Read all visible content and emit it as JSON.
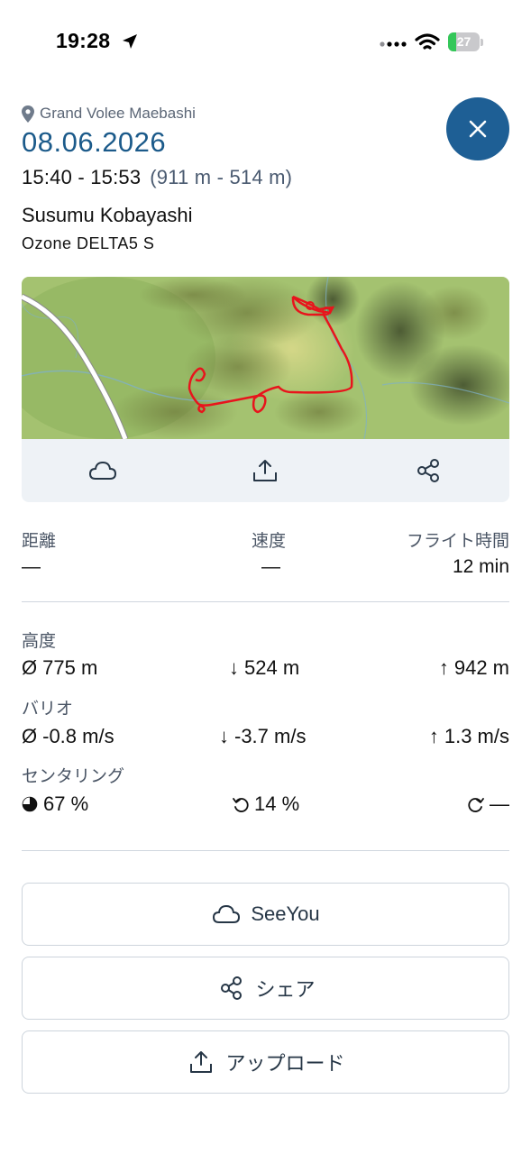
{
  "status_bar": {
    "time": "19:28",
    "battery": "27",
    "battery_level": 0.27,
    "colors": {
      "battery_fill": "#34c759",
      "battery_body": "#c9c9cc"
    }
  },
  "flight": {
    "place": "Grand Volee Maebashi",
    "date": "08.06.2026",
    "time_range": "15:40 - 15:53",
    "altitude_range": "(911 m - 514 m)",
    "pilot": "Susumu Kobayashi",
    "glider": "Ozone DELTA5 S"
  },
  "map_actions": [
    {
      "icon": "cloud-icon"
    },
    {
      "icon": "upload-icon"
    },
    {
      "icon": "share-icon"
    }
  ],
  "summary": {
    "distance_label": "距離",
    "distance_value": "—",
    "speed_label": "速度",
    "speed_value": "—",
    "flight_time_label": "フライト時間",
    "flight_time_value": "12 min"
  },
  "altitude": {
    "label": "高度",
    "avg": "775 m",
    "min": "524 m",
    "max": "942 m"
  },
  "vario": {
    "label": "バリオ",
    "avg": "-0.8 m/s",
    "min": "-3.7 m/s",
    "max": "1.3 m/s"
  },
  "centering": {
    "label": "センタリング",
    "total": "67 %",
    "left": "14 %",
    "right": "—"
  },
  "symbols": {
    "average": "Ø",
    "down": "↓",
    "up": "↑"
  },
  "buttons": {
    "seeyou": "SeeYou",
    "share": "シェア",
    "upload": "アップロード"
  },
  "colors": {
    "accent": "#1e5f95",
    "date_text": "#1b5a8a",
    "track": "#e8141c"
  }
}
